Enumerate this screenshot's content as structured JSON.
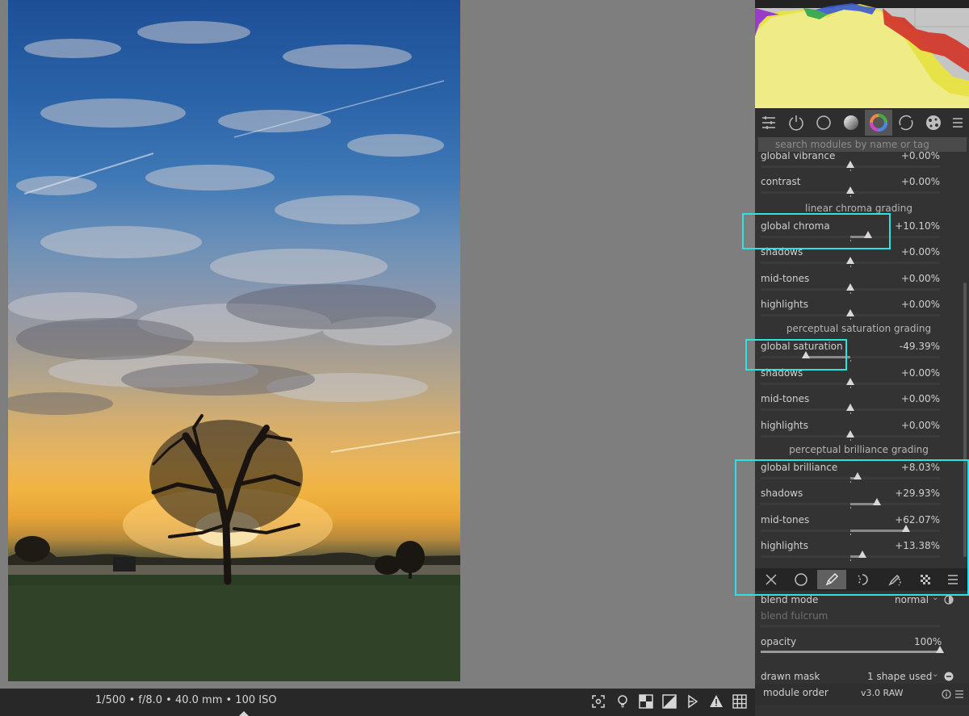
{
  "bottombar": {
    "exif": "1/500 • f/8.0 • 40.0 mm • 100 ISO",
    "icons": [
      "focus-peaking-icon",
      "color-assessment-icon",
      "softproof-icon",
      "gamut-check-icon",
      "raw-overexposed-icon",
      "clipping-warning-icon",
      "guides-icon"
    ]
  },
  "panel": {
    "tabs": [
      "quick-access-icon",
      "active-modules-icon",
      "base-group-icon",
      "tone-group-icon",
      "color-group-icon",
      "correct-group-icon",
      "effect-group-icon",
      "presets-menu-icon"
    ],
    "active_tab": 4,
    "search_placeholder": "search modules by name or tag",
    "top_rows": [
      {
        "label": "global vibrance",
        "value": "+0.00%",
        "pos": 0.5
      },
      {
        "label": "contrast",
        "value": "+0.00%",
        "pos": 0.5
      }
    ],
    "sections": [
      {
        "title": "linear chroma grading",
        "rows": [
          {
            "label": "global chroma",
            "value": "+10.10%",
            "pos": 0.6
          },
          {
            "label": "shadows",
            "value": "+0.00%",
            "pos": 0.5
          },
          {
            "label": "mid-tones",
            "value": "+0.00%",
            "pos": 0.5
          },
          {
            "label": "highlights",
            "value": "+0.00%",
            "pos": 0.5
          }
        ]
      },
      {
        "title": "perceptual saturation grading",
        "rows": [
          {
            "label": "global saturation",
            "value": "-49.39%",
            "pos": 0.253
          },
          {
            "label": "shadows",
            "value": "+0.00%",
            "pos": 0.5
          },
          {
            "label": "mid-tones",
            "value": "+0.00%",
            "pos": 0.5
          },
          {
            "label": "highlights",
            "value": "+0.00%",
            "pos": 0.5
          }
        ]
      },
      {
        "title": "perceptual brilliance grading",
        "rows": [
          {
            "label": "global brilliance",
            "value": "+8.03%",
            "pos": 0.54
          },
          {
            "label": "shadows",
            "value": "+29.93%",
            "pos": 0.65
          },
          {
            "label": "mid-tones",
            "value": "+62.07%",
            "pos": 0.81
          },
          {
            "label": "highlights",
            "value": "+13.38%",
            "pos": 0.567
          }
        ]
      }
    ],
    "blend_toolbar": [
      "blend-off-icon",
      "uniform-blend-icon",
      "drawn-mask-icon",
      "parametric-mask-icon",
      "drawn-parametric-mask-icon",
      "raster-mask-icon",
      "blend-menu-icon"
    ],
    "blend_active": 2,
    "blend": {
      "blend_mode_label": "blend mode",
      "blend_mode_value": "normal",
      "blend_fulcrum_label": "blend fulcrum",
      "opacity_label": "opacity",
      "opacity_value": "100%",
      "opacity": 1.0,
      "drawn_mask_label": "drawn mask",
      "drawn_mask_value": "1 shape used"
    },
    "footer": {
      "module_order_label": "module order",
      "module_order_value": "v3.0 RAW"
    }
  },
  "colors": {
    "highlight": "#2ee2e2",
    "panel_bg": "#333333"
  }
}
